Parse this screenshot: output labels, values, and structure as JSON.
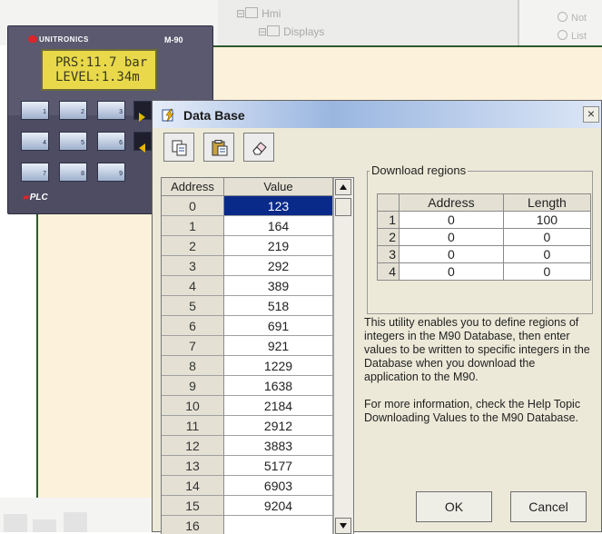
{
  "background": {
    "tree": {
      "item1": "Hmi",
      "item2": "Displays"
    },
    "radios": [
      "Not",
      "List"
    ]
  },
  "device": {
    "brand": "UNITRONICS",
    "model": "M-90",
    "lcd_line1": "PRS:11.7 bar",
    "lcd_line2": "LEVEL:1.34m",
    "keys": [
      "1",
      "2",
      "3",
      "4",
      "5",
      "6",
      "7",
      "8",
      "9"
    ],
    "logo": "PLC"
  },
  "dialog": {
    "title": "Data Base",
    "close": "×",
    "toolbar": [
      {
        "icon": "copy-icon"
      },
      {
        "icon": "paste-icon"
      },
      {
        "icon": "eraser-icon"
      }
    ],
    "grid": {
      "col_address": "Address",
      "col_value": "Value",
      "rows": [
        {
          "address": "0",
          "value": "123"
        },
        {
          "address": "1",
          "value": "164"
        },
        {
          "address": "2",
          "value": "219"
        },
        {
          "address": "3",
          "value": "292"
        },
        {
          "address": "4",
          "value": "389"
        },
        {
          "address": "5",
          "value": "518"
        },
        {
          "address": "6",
          "value": "691"
        },
        {
          "address": "7",
          "value": "921"
        },
        {
          "address": "8",
          "value": "1229"
        },
        {
          "address": "9",
          "value": "1638"
        },
        {
          "address": "10",
          "value": "2184"
        },
        {
          "address": "11",
          "value": "2912"
        },
        {
          "address": "12",
          "value": "3883"
        },
        {
          "address": "13",
          "value": "5177"
        },
        {
          "address": "14",
          "value": "6903"
        },
        {
          "address": "15",
          "value": "9204"
        },
        {
          "address": "16",
          "value": ""
        }
      ]
    },
    "regions": {
      "label": "Download regions",
      "col_address": "Address",
      "col_length": "Length",
      "rows": [
        {
          "index": "1",
          "address": "0",
          "length": "100"
        },
        {
          "index": "2",
          "address": "0",
          "length": "0"
        },
        {
          "index": "3",
          "address": "0",
          "length": "0"
        },
        {
          "index": "4",
          "address": "0",
          "length": "0"
        }
      ]
    },
    "description1": "This utility enables you to define regions of integers in the M90 Database, then enter values to be written to specific integers in the Database when you download the application to the M90.",
    "description2": "For more information, check the Help Topic Downloading Values to the M90 Database.",
    "ok_label": "OK",
    "cancel_label": "Cancel"
  }
}
